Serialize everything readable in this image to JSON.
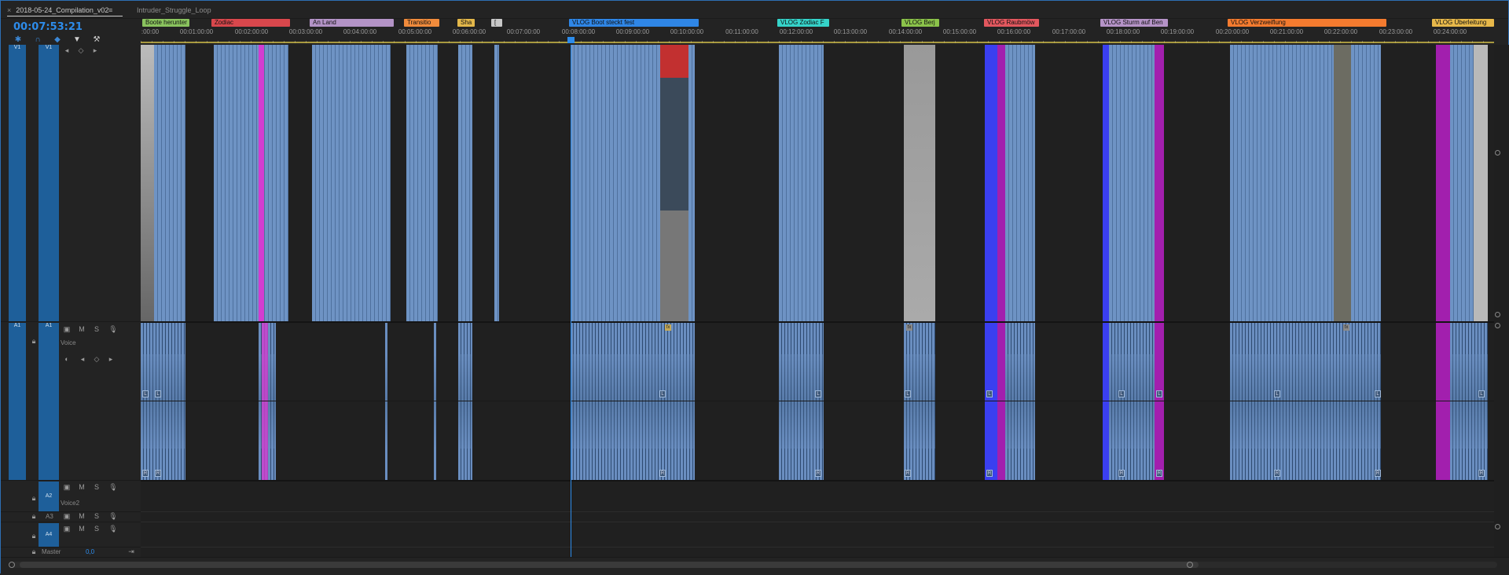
{
  "tabs": {
    "active": "2018-05-24_Compilation_v02",
    "close": "×",
    "menu": "≡",
    "second": "Intruder_Struggle_Loop"
  },
  "timecode": "00:07:53:21",
  "tools": [
    "snap-icon",
    "linked-selection-icon",
    "add-marker-icon",
    "marker-icon",
    "wrench-icon"
  ],
  "markers": [
    {
      "label": "Boote herunter",
      "color": "#8ac35e"
    },
    {
      "label": "Zodiac",
      "color": "#d8474c"
    },
    {
      "label": "An Land",
      "color": "#b393c6"
    },
    {
      "label": "Transitio",
      "color": "#f08b3c"
    },
    {
      "label": "Sha",
      "color": "#e3b74a"
    },
    {
      "label": "[",
      "color": "#c8c8c8"
    },
    {
      "label": "VLOG Boot steckt fest",
      "color": "#2f86e6"
    },
    {
      "label": "VLOG Zodiac F",
      "color": "#35d3c9"
    },
    {
      "label": "VLOG Berj",
      "color": "#8bc34a"
    },
    {
      "label": "VLOG Raubmöw",
      "color": "#e2575e"
    },
    {
      "label": "VLOG Sturm auf Ben",
      "color": "#b593c7"
    },
    {
      "label": "VLOG Verzweiflung",
      "color": "#f47b2f"
    },
    {
      "label": "VLOG Überleitung",
      "color": "#e7b84a"
    }
  ],
  "ruler_ticks": [
    ":00:00",
    "00:01:00:00",
    "00:02:00:00",
    "00:03:00:00",
    "00:04:00:00",
    "00:05:00:00",
    "00:06:00:00",
    "00:07:00:00",
    "00:08:00:00",
    "00:09:00:00",
    "00:10:00:00",
    "00:11:00:00",
    "00:12:00:00",
    "00:13:00:00",
    "00:14:00:00",
    "00:15:00:00",
    "00:16:00:00",
    "00:17:00:00",
    "00:18:00:00",
    "00:19:00:00",
    "00:20:00:00",
    "00:21:00:00",
    "00:22:00:00",
    "00:23:00:00",
    "00:24:00:00"
  ],
  "tracks": {
    "v1_source": "V1",
    "v1_target": "V1",
    "a1_source": "A1",
    "a1_target": "A1",
    "a1_name": "Voice",
    "a2_target": "A2",
    "a2_name": "Voice2",
    "a3_target": "A3",
    "a4_target": "A4",
    "master_label": "Master",
    "master_value": "0,0",
    "m": "M",
    "s": "S",
    "channel_left": "L",
    "channel_right": "R",
    "fx": "fx"
  },
  "clip_colors": {
    "video": "#6e93c4",
    "magenta": "#d23dd0",
    "purple": "#a21fae",
    "blue": "#3a3ff0",
    "playhead": "#2d8ceb"
  }
}
